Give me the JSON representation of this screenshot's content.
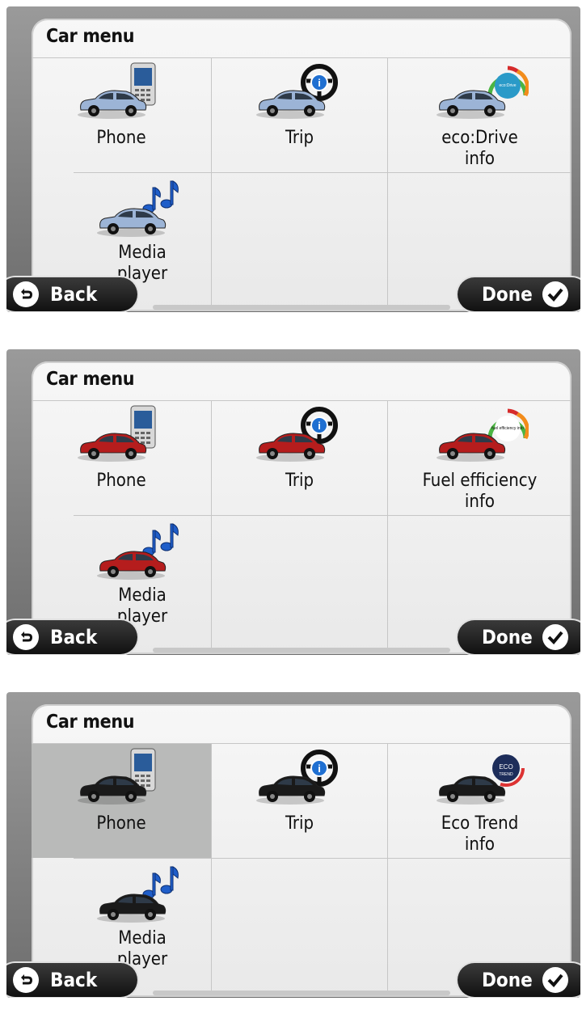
{
  "screens": [
    {
      "title": "Car menu",
      "car_color": "#9cb4d6",
      "items": [
        {
          "label": "Phone",
          "icon": "phone-icon"
        },
        {
          "label": "Trip",
          "icon": "trip-info-icon"
        },
        {
          "label": "eco:Drive\ninfo",
          "icon": "eco-drive-gauge-icon"
        },
        {
          "label": "Media\nplayer",
          "icon": "music-notes-icon"
        }
      ],
      "back_label": "Back",
      "done_label": "Done",
      "gauge_label": "eco:Drive"
    },
    {
      "title": "Car menu",
      "car_color": "#b51d1d",
      "items": [
        {
          "label": "Phone",
          "icon": "phone-icon"
        },
        {
          "label": "Trip",
          "icon": "trip-info-icon"
        },
        {
          "label": "Fuel efficiency\ninfo",
          "icon": "fuel-efficiency-gauge-icon"
        },
        {
          "label": "Media\nplayer",
          "icon": "music-notes-icon"
        }
      ],
      "back_label": "Back",
      "done_label": "Done",
      "gauge_label": "fuel efficiency info"
    },
    {
      "title": "Car menu",
      "car_color": "#1a1a1a",
      "items": [
        {
          "label": "Phone",
          "icon": "phone-icon",
          "selected": true
        },
        {
          "label": "Trip",
          "icon": "trip-info-icon"
        },
        {
          "label": "Eco Trend\ninfo",
          "icon": "eco-trend-gauge-icon"
        },
        {
          "label": "Media\nplayer",
          "icon": "music-notes-icon"
        }
      ],
      "back_label": "Back",
      "done_label": "Done",
      "gauge_label": "ECO TREND"
    }
  ]
}
